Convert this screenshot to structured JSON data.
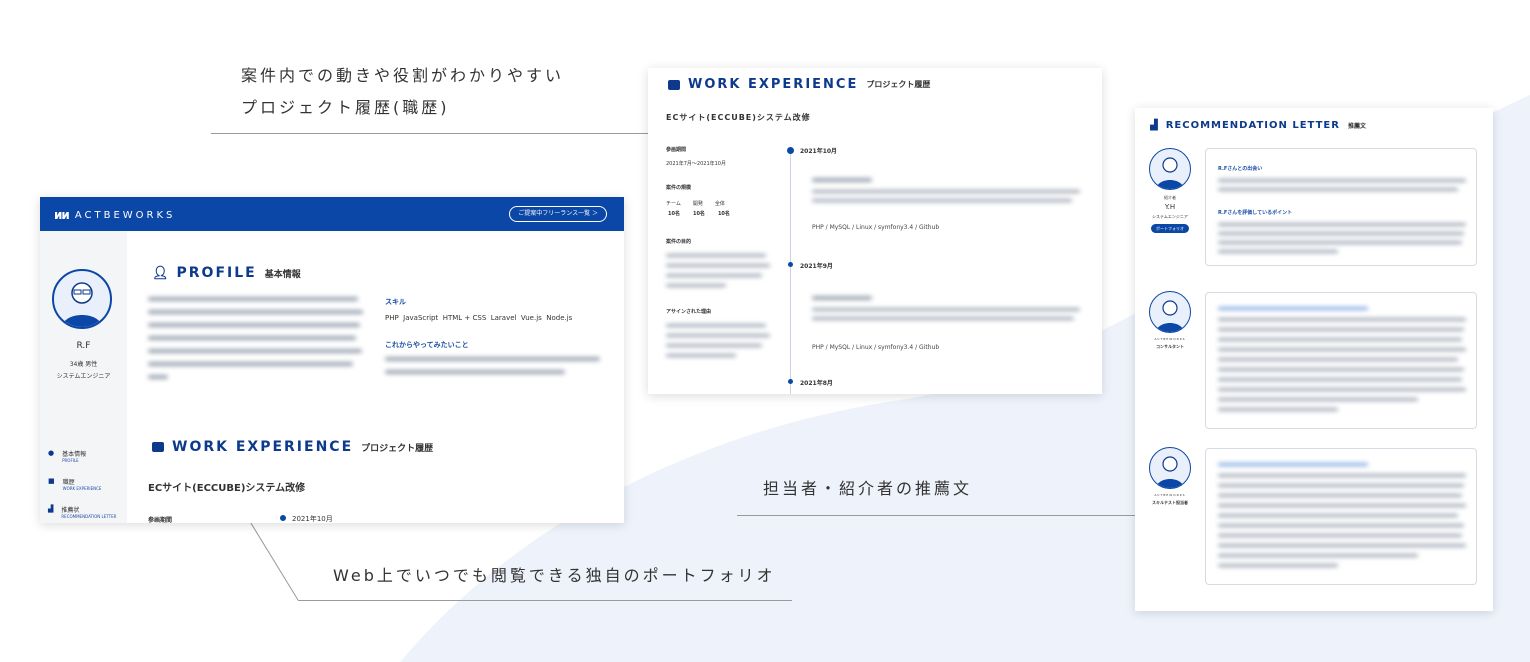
{
  "captions": {
    "top_line1": "案件内での動きや役割がわかりやすい",
    "top_line2": "プロジェクト履歴(職歴)",
    "middle": "担当者・紹介者の推薦文",
    "bottom": "Web上でいつでも閲覧できる独自のポートフォリオ"
  },
  "colors": {
    "brand": "#0b47a6",
    "navy": "#0d3a8c",
    "background_shape": "#eef3fb"
  },
  "profile_card": {
    "logo": "ACTBEWORKS",
    "header_button": "ご提案中フリーランス一覧 ＞",
    "user_name": "R.F",
    "user_meta": "34歳 男性",
    "user_role": "システムエンジニア",
    "menu": [
      {
        "label": "基本情報",
        "sub": "PROFILE",
        "icon": "person-icon"
      },
      {
        "label": "職歴",
        "sub": "WORK EXPERIENCE",
        "icon": "briefcase-icon"
      },
      {
        "label": "推薦状",
        "sub": "RECOMMENDATION LETTER",
        "icon": "chart-icon"
      }
    ],
    "profile_title": "PROFILE",
    "profile_subtitle": "基本情報",
    "skills_label": "スキル",
    "skills": "PHP  JavaScript  HTML + CSS  Laravel  Vue.js  Node.js",
    "future_label": "これからやってみたいこと",
    "work_title": "WORK EXPERIENCE",
    "work_subtitle": "プロジェクト履歴",
    "project_name": "ECサイト(ECCUBE)システム改修",
    "period_label": "参画期間",
    "timeline_date": "2021年10月"
  },
  "work_card": {
    "title": "WORK EXPERIENCE",
    "subtitle": "プロジェクト履歴",
    "project_name": "ECサイト(ECCUBE)システム改修",
    "period_label": "参画期間",
    "period_value": "2021年7月～2021年10月",
    "scale_label": "案件の規模",
    "scale_headers": [
      "チーム",
      "開発",
      "全体"
    ],
    "scale_values": [
      "10名",
      "10名",
      "10名"
    ],
    "purpose_label": "案件の目的",
    "reason_label": "アサインされた理由",
    "timeline": [
      {
        "date": "2021年10月",
        "tech": "PHP / MySQL / Linux / symfony3.4 / Github"
      },
      {
        "date": "2021年9月",
        "tech": "PHP / MySQL / Linux / symfony3.4 / Github"
      },
      {
        "date": "2021年8月",
        "tech": ""
      }
    ]
  },
  "letter_card": {
    "title": "RECOMMENDATION LETTER",
    "subtitle": "推薦文",
    "recommenders": [
      {
        "small": "紹介者",
        "name": "Y.H",
        "role": "システムエンジニア",
        "badge": "ポートフォリオ",
        "heading1": "R.Fさんとの出会い",
        "heading2": "R.Fさんを評価しているポイント"
      },
      {
        "small": "ACTBEWORKS",
        "name": "",
        "role": "コンサルタント",
        "badge": "",
        "heading1": "",
        "heading2": ""
      },
      {
        "small": "ACTBEWORKS",
        "name": "",
        "role": "スキルテスト担当者",
        "badge": "",
        "heading1": "",
        "heading2": ""
      }
    ]
  }
}
